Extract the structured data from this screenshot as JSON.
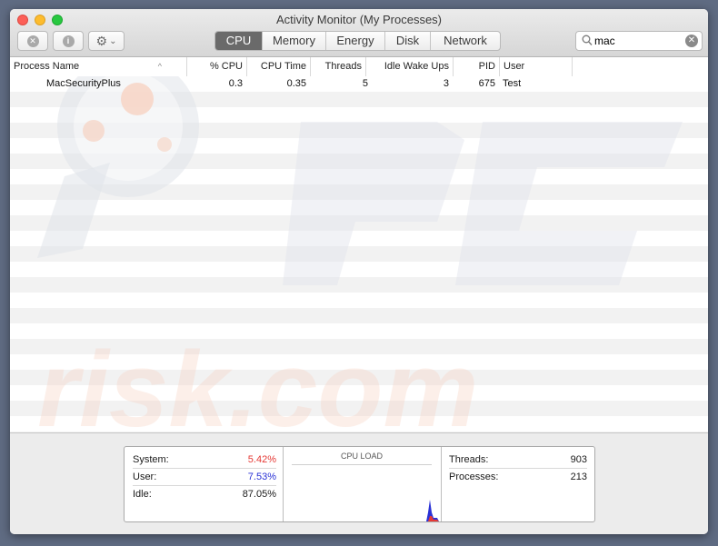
{
  "window": {
    "title": "Activity Monitor (My Processes)"
  },
  "toolbar": {
    "stop_icon": "close-icon",
    "info_icon": "info-icon",
    "info_glyph": "i",
    "stop_glyph": "✕",
    "gear_glyph": "⚙",
    "chevron_glyph": "⌄",
    "tabs": [
      {
        "label": "CPU",
        "active": true
      },
      {
        "label": "Memory",
        "active": false
      },
      {
        "label": "Energy",
        "active": false
      },
      {
        "label": "Disk",
        "active": false
      },
      {
        "label": "Network",
        "active": false
      }
    ],
    "search_value": "mac",
    "clear_glyph": "✕"
  },
  "table": {
    "columns": [
      "Process Name",
      "% CPU",
      "CPU Time",
      "Threads",
      "Idle Wake Ups",
      "PID",
      "User"
    ],
    "sort_glyph": "^",
    "rows": [
      {
        "name": "MacSecurityPlus",
        "cpu": "0.3",
        "cpu_time": "0.35",
        "threads": "5",
        "idle_wake_ups": "3",
        "pid": "675",
        "user": "Test"
      }
    ]
  },
  "summary": {
    "system_label": "System:",
    "system_value": "5.42%",
    "user_label": "User:",
    "user_value": "7.53%",
    "idle_label": "Idle:",
    "idle_value": "87.05%",
    "cpu_load_title": "CPU LOAD",
    "threads_label": "Threads:",
    "threads_value": "903",
    "processes_label": "Processes:",
    "processes_value": "213"
  },
  "colors": {
    "system": "#e53935",
    "user": "#2a32d6",
    "active_tab": "#6a6a6a",
    "watermark": "#e0e3ea",
    "watermark_accent": "#f7d2c2"
  }
}
